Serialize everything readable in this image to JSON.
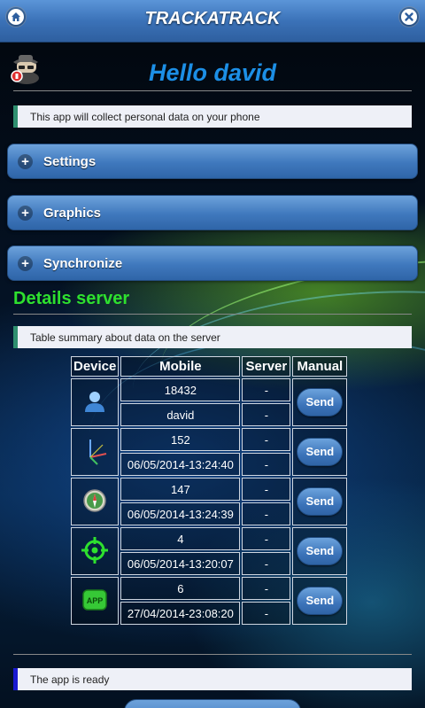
{
  "header": {
    "title": "TRACKATRACK",
    "home_icon": "home-icon",
    "close_icon": "close-icon"
  },
  "greeting": {
    "text": "Hello david"
  },
  "notice": {
    "text": "This app will collect personal data on your phone"
  },
  "sections": [
    {
      "label": "Settings"
    },
    {
      "label": "Graphics"
    },
    {
      "label": "Synchronize"
    }
  ],
  "details": {
    "title": "Details server",
    "summary": "Table summary about data on the server",
    "headers": {
      "device": "Device",
      "mobile": "Mobile",
      "server": "Server",
      "manual": "Manual"
    },
    "send_label": "Send",
    "rows": [
      {
        "icon": "user-icon",
        "mobile_top": "18432",
        "mobile_bottom": "david",
        "server_top": "-",
        "server_bottom": "-"
      },
      {
        "icon": "axes-icon",
        "mobile_top": "152",
        "mobile_bottom": "06/05/2014-13:24:40",
        "server_top": "-",
        "server_bottom": "-"
      },
      {
        "icon": "compass-icon",
        "mobile_top": "147",
        "mobile_bottom": "06/05/2014-13:24:39",
        "server_top": "-",
        "server_bottom": "-"
      },
      {
        "icon": "target-icon",
        "mobile_top": "4",
        "mobile_bottom": "06/05/2014-13:20:07",
        "server_top": "-",
        "server_bottom": "-"
      },
      {
        "icon": "app-icon",
        "mobile_top": "6",
        "mobile_bottom": "27/04/2014-23:08:20",
        "server_top": "-",
        "server_bottom": "-"
      }
    ]
  },
  "status": {
    "text": "The app is ready"
  },
  "colors": {
    "header": "#3b72b8",
    "hello": "#1c8fe6",
    "section_title": "#2ee02e"
  }
}
